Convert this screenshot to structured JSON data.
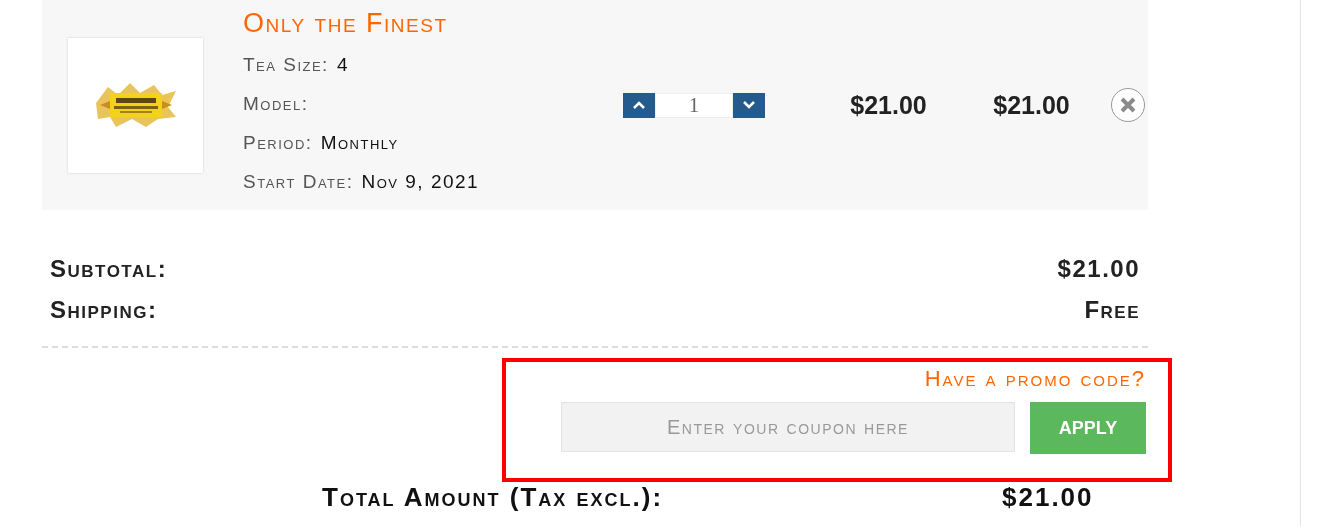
{
  "cart_item": {
    "title": "Only the Finest",
    "attributes": [
      {
        "label": "Tea Size:",
        "value": "4"
      },
      {
        "label": "Model:"
      },
      {
        "label": "Period:",
        "value": "Monthly"
      },
      {
        "label": "Start Date:",
        "value": "Nov 9, 2021"
      }
    ],
    "quantity": "1",
    "unit_price": "$21.00",
    "total_price": "$21.00"
  },
  "summary": [
    {
      "label": "Subtotal:",
      "value": "$21.00"
    },
    {
      "label": "Shipping:",
      "value": "Free"
    }
  ],
  "promo": {
    "heading": "Have a promo code?",
    "placeholder": "Enter your coupon here",
    "button": "APPLY"
  },
  "total": {
    "label": "Total Amount (Tax excl.):",
    "value": "$21.00"
  }
}
